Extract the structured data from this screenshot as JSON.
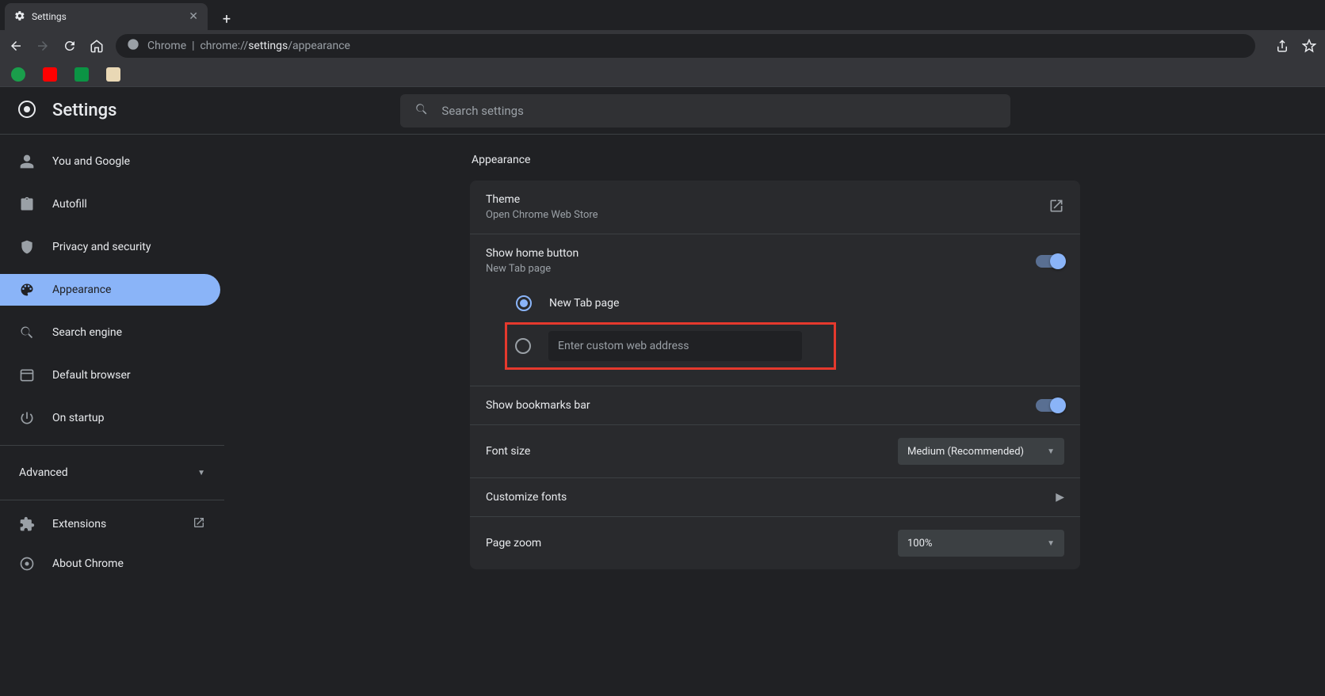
{
  "browser": {
    "tab_title": "Settings",
    "url_prefix": "Chrome",
    "url_scheme": "chrome://",
    "url_bold": "settings",
    "url_rest": "/appearance"
  },
  "header": {
    "title": "Settings",
    "search_placeholder": "Search settings"
  },
  "sidebar": {
    "items": [
      {
        "label": "You and Google"
      },
      {
        "label": "Autofill"
      },
      {
        "label": "Privacy and security"
      },
      {
        "label": "Appearance"
      },
      {
        "label": "Search engine"
      },
      {
        "label": "Default browser"
      },
      {
        "label": "On startup"
      }
    ],
    "advanced": "Advanced",
    "extensions": "Extensions",
    "about": "About Chrome"
  },
  "content": {
    "section": "Appearance",
    "theme_title": "Theme",
    "theme_sub": "Open Chrome Web Store",
    "home_title": "Show home button",
    "home_sub": "New Tab page",
    "radio_new_tab": "New Tab page",
    "custom_placeholder": "Enter custom web address",
    "bookmarks_title": "Show bookmarks bar",
    "font_size_title": "Font size",
    "font_size_value": "Medium (Recommended)",
    "customize_fonts": "Customize fonts",
    "page_zoom_title": "Page zoom",
    "page_zoom_value": "100%"
  }
}
